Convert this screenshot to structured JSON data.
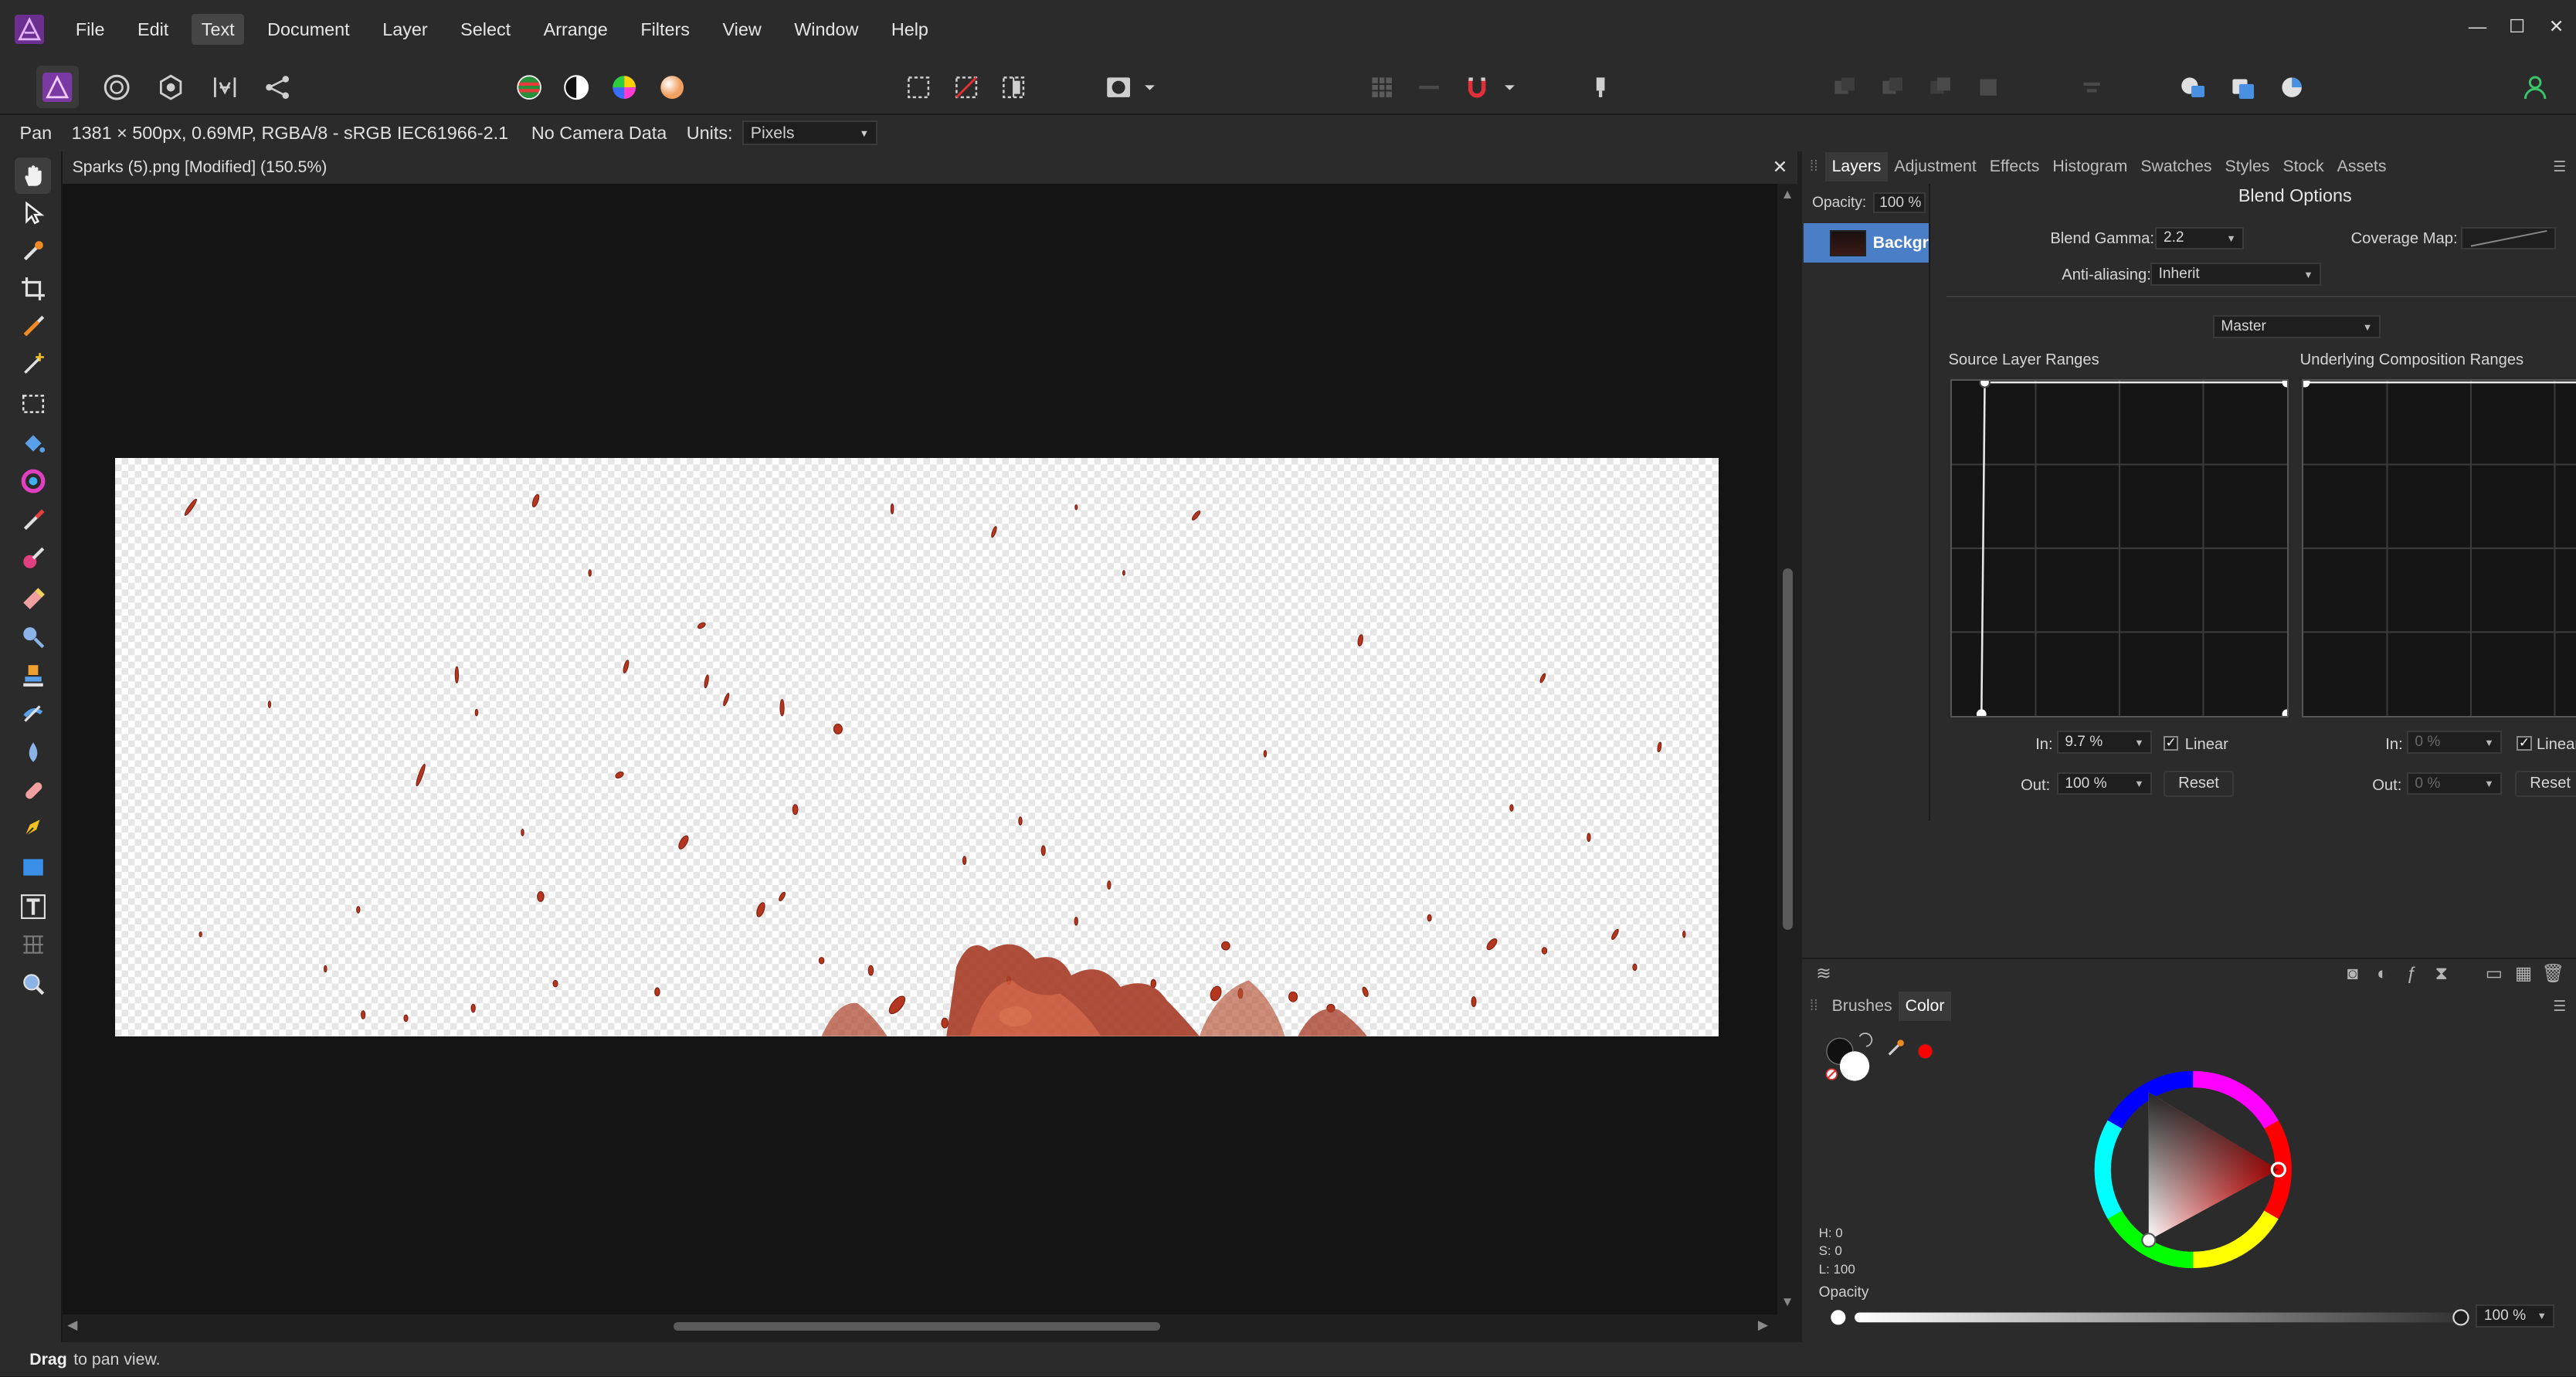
{
  "menu": {
    "items": [
      "File",
      "Edit",
      "Text",
      "Document",
      "Layer",
      "Select",
      "Arrange",
      "Filters",
      "View",
      "Window",
      "Help"
    ],
    "active": "Text"
  },
  "window_controls": {
    "minimize": "—",
    "maximize": "☐",
    "close": "✕"
  },
  "context_bar": {
    "tool": "Pan",
    "image_info": "1381 × 500px, 0.69MP, RGBA/8 - sRGB IEC61966-2.1",
    "camera": "No Camera Data",
    "units_label": "Units:",
    "units_value": "Pixels"
  },
  "document": {
    "title": "Sparks (5).png [Modified] (150.5%)",
    "close": "✕"
  },
  "status": {
    "bold": "Drag",
    "text": "to pan view."
  },
  "layers_panel": {
    "tabs": [
      "Layers",
      "Adjustment",
      "Effects",
      "Histogram",
      "Swatches",
      "Styles",
      "Stock",
      "Assets"
    ],
    "active_tab": "Layers",
    "opacity_label": "Opacity:",
    "opacity_value": "100 %",
    "layer_name": "Background"
  },
  "blend_options": {
    "title": "Blend Options",
    "gamma_label": "Blend Gamma:",
    "gamma_value": "2.2",
    "coverage_label": "Coverage Map:",
    "antialias_label": "Anti-aliasing:",
    "antialias_value": "Inherit",
    "channel": "Master",
    "source_title": "Source Layer Ranges",
    "underlying_title": "Underlying Composition Ranges",
    "source": {
      "in_label": "In:",
      "in_value": "9.7 %",
      "out_label": "Out:",
      "out_value": "100 %",
      "linear_label": "Linear",
      "linear_checked": true,
      "reset": "Reset"
    },
    "underlying": {
      "in_label": "In:",
      "in_value": "0 %",
      "out_label": "Out:",
      "out_value": "0 %",
      "linear_label": "Linear",
      "linear_checked": true,
      "reset": "Reset"
    }
  },
  "color_panel": {
    "tabs": [
      "Brushes",
      "Color"
    ],
    "active_tab": "Color",
    "h": "H: 0",
    "s": "S: 0",
    "l": "L: 100",
    "opacity_label": "Opacity",
    "opacity_value": "100 %",
    "current_color": "#ff0000"
  },
  "colors": {
    "accent": "#4a7fc7",
    "spark": "#b5361e"
  }
}
